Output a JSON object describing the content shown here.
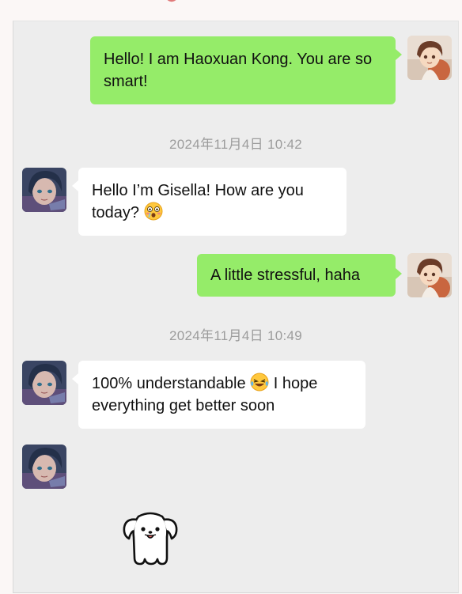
{
  "messages": [
    {
      "sender": "me",
      "text": "Hello! I am Haoxuan Kong. You are so smart!"
    },
    {
      "timestamp": "2024年11月4日 10:42"
    },
    {
      "sender": "them",
      "text": "Hello I’m Gisella! How are you today?",
      "emoji": "flushed-face-emoji"
    },
    {
      "sender": "me",
      "text": "A little stressful, haha"
    },
    {
      "timestamp": "2024年11月4日 10:49"
    },
    {
      "sender": "them",
      "text_before": "100% understandable",
      "emoji": "laughing-crying-emoji",
      "text_after": "I hope everything get better soon"
    },
    {
      "sender": "them",
      "sticker": "white-puppy-sticker"
    }
  ],
  "colors": {
    "chat_background": "#ededed",
    "my_bubble": "#95ec69",
    "their_bubble": "#ffffff",
    "timestamp_text": "#9c9c9c"
  }
}
